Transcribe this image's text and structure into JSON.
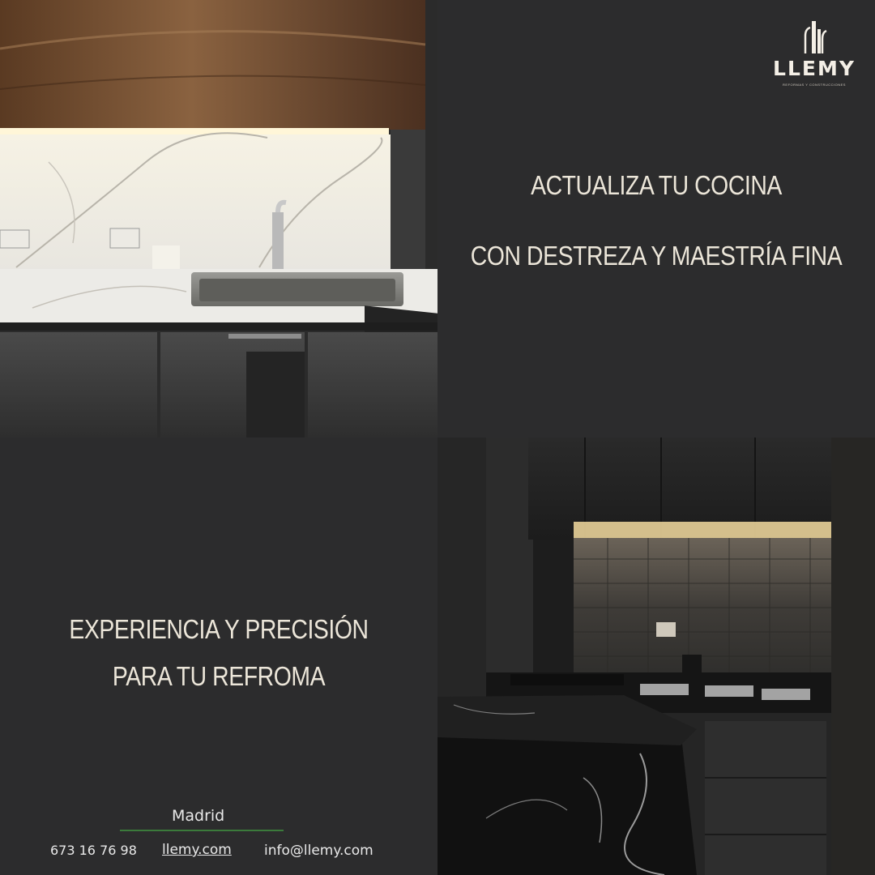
{
  "brand": {
    "name": "LLEMY",
    "tagline": "Reformas y Construcciones"
  },
  "headlines": {
    "line1": "ACTUALIZA TU COCINA",
    "line2": "CON DESTREZA Y MAESTRÍA FINA",
    "line3": "EXPERIENCIA Y PRECISIÓN",
    "line4": "PARA TU REFROMA"
  },
  "footer": {
    "city": "Madrid",
    "phone": "673 16 76 98",
    "website": "llemy.com",
    "email": "info@llemy.com"
  },
  "colors": {
    "background": "#2c2c2d",
    "headline_text": "#ece6d9",
    "divider": "#3b7a3b"
  }
}
